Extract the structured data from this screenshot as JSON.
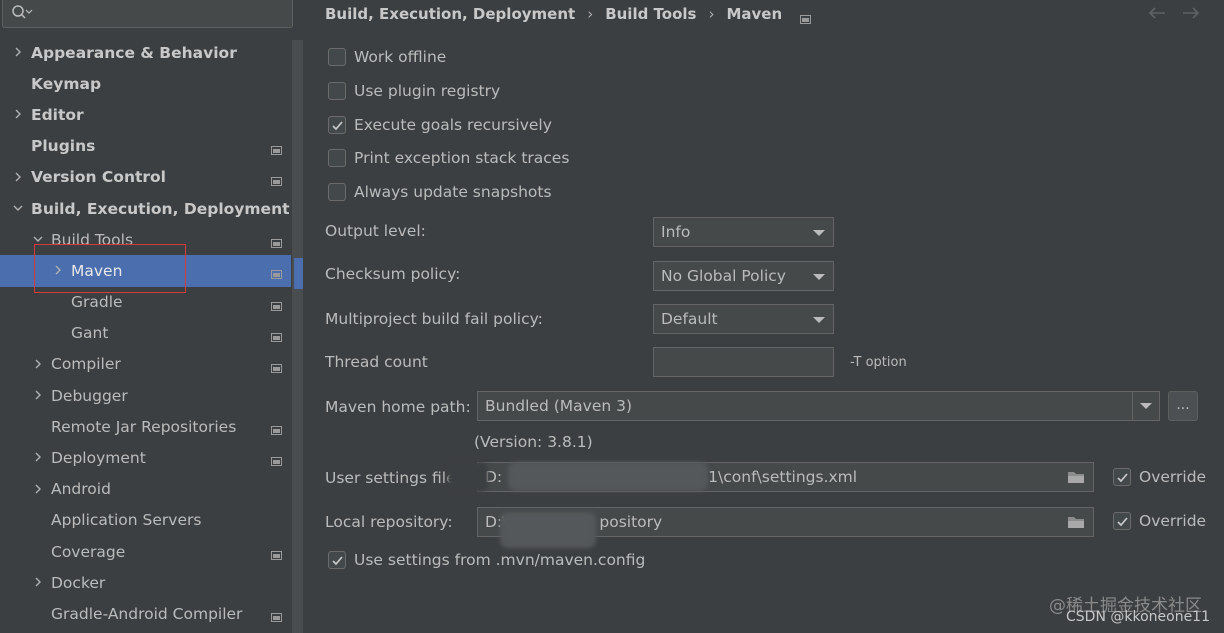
{
  "search": {
    "placeholder": ""
  },
  "sidebar": {
    "items": [
      {
        "label": "Appearance & Behavior",
        "bold": true,
        "level": 0,
        "expand": "collapsed",
        "project_icon": false
      },
      {
        "label": "Keymap",
        "bold": true,
        "level": 0,
        "expand": "none",
        "project_icon": false
      },
      {
        "label": "Editor",
        "bold": true,
        "level": 0,
        "expand": "collapsed",
        "project_icon": false
      },
      {
        "label": "Plugins",
        "bold": true,
        "level": 0,
        "expand": "none",
        "project_icon": true
      },
      {
        "label": "Version Control",
        "bold": true,
        "level": 0,
        "expand": "collapsed",
        "project_icon": true
      },
      {
        "label": "Build, Execution, Deployment",
        "bold": true,
        "level": 0,
        "expand": "expanded",
        "project_icon": false
      },
      {
        "label": "Build Tools",
        "bold": false,
        "level": 1,
        "expand": "expanded",
        "project_icon": true
      },
      {
        "label": "Maven",
        "bold": false,
        "level": 2,
        "expand": "collapsed",
        "project_icon": true,
        "selected": true
      },
      {
        "label": "Gradle",
        "bold": false,
        "level": 2,
        "expand": "none",
        "project_icon": true
      },
      {
        "label": "Gant",
        "bold": false,
        "level": 2,
        "expand": "none",
        "project_icon": true
      },
      {
        "label": "Compiler",
        "bold": false,
        "level": 1,
        "expand": "collapsed",
        "project_icon": true
      },
      {
        "label": "Debugger",
        "bold": false,
        "level": 1,
        "expand": "collapsed",
        "project_icon": false
      },
      {
        "label": "Remote Jar Repositories",
        "bold": false,
        "level": 1,
        "expand": "none",
        "project_icon": true
      },
      {
        "label": "Deployment",
        "bold": false,
        "level": 1,
        "expand": "collapsed",
        "project_icon": true
      },
      {
        "label": "Android",
        "bold": false,
        "level": 1,
        "expand": "collapsed",
        "project_icon": false
      },
      {
        "label": "Application Servers",
        "bold": false,
        "level": 1,
        "expand": "none",
        "project_icon": false
      },
      {
        "label": "Coverage",
        "bold": false,
        "level": 1,
        "expand": "none",
        "project_icon": true
      },
      {
        "label": "Docker",
        "bold": false,
        "level": 1,
        "expand": "collapsed",
        "project_icon": false
      },
      {
        "label": "Gradle-Android Compiler",
        "bold": false,
        "level": 1,
        "expand": "none",
        "project_icon": true
      }
    ]
  },
  "breadcrumb": {
    "part1": "Build, Execution, Deployment",
    "part2": "Build Tools",
    "part3": "Maven",
    "sep": "›"
  },
  "checkboxes": {
    "work_offline": {
      "label": "Work offline",
      "checked": false
    },
    "plugin_registry": {
      "label": "Use plugin registry",
      "checked": false
    },
    "recursive": {
      "label": "Execute goals recursively",
      "checked": true
    },
    "stack_traces": {
      "label": "Print exception stack traces",
      "checked": false
    },
    "snapshots": {
      "label": "Always update snapshots",
      "checked": false
    },
    "mvn_config": {
      "label": "Use settings from .mvn/maven.config",
      "checked": true
    }
  },
  "fields": {
    "output_level": {
      "label": "Output level:",
      "value": "Info"
    },
    "checksum": {
      "label": "Checksum policy:",
      "value": "No Global Policy"
    },
    "fail_policy": {
      "label": "Multiproject build fail policy:",
      "value": "Default"
    },
    "thread_count": {
      "label": "Thread count",
      "value": "",
      "hint": "-T option"
    },
    "home_path": {
      "label": "Maven home path:",
      "value": "Bundled (Maven 3)",
      "browse": "...",
      "version": "(Version: 3.8.1)"
    },
    "user_settings": {
      "label": "User settings file:",
      "value_start": "D:",
      "value_end": "1\\conf\\settings.xml",
      "override": "Override",
      "override_checked": true
    },
    "local_repo": {
      "label": "Local repository:",
      "value_start": "D:\\",
      "value_end": "pository",
      "override": "Override",
      "override_checked": true
    }
  },
  "watermark": "@稀土掘金技术社区",
  "credit": "CSDN @kkoneone11"
}
